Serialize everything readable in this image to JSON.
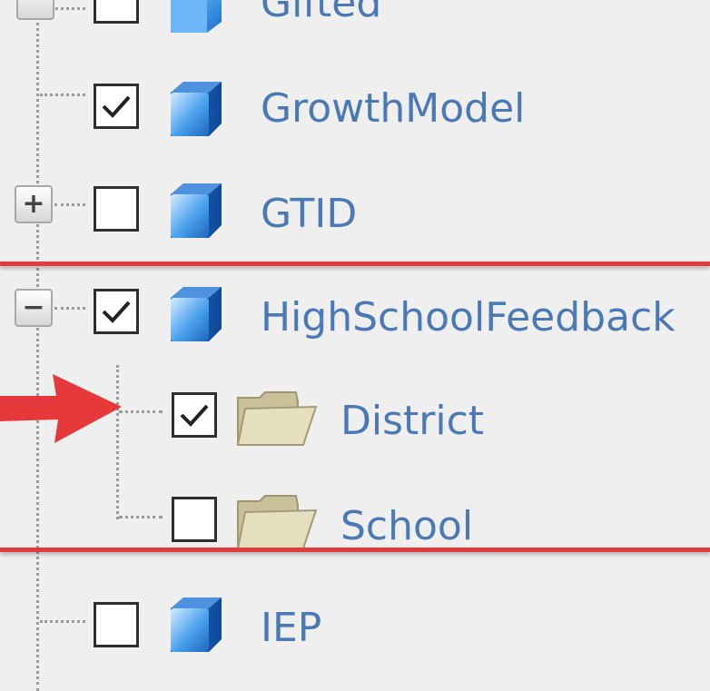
{
  "tree": {
    "items": [
      {
        "label": "Gifted",
        "checked": false,
        "kind": "cube",
        "expander": "none"
      },
      {
        "label": "GrowthModel",
        "checked": true,
        "kind": "cube",
        "expander": "none"
      },
      {
        "label": "GTID",
        "checked": false,
        "kind": "cube",
        "expander": "+"
      },
      {
        "label": "HighSchoolFeedback",
        "checked": true,
        "kind": "cube",
        "expander": "−"
      },
      {
        "label": "District",
        "checked": true,
        "kind": "folder",
        "expander": "none"
      },
      {
        "label": "School",
        "checked": false,
        "kind": "folder",
        "expander": "none"
      },
      {
        "label": "IEP",
        "checked": false,
        "kind": "cube",
        "expander": "none"
      }
    ]
  },
  "annotation": {
    "color": "#e23b3b",
    "arrow_target": "District"
  },
  "colors": {
    "label": "#4a79b6",
    "background": "#efefef"
  }
}
